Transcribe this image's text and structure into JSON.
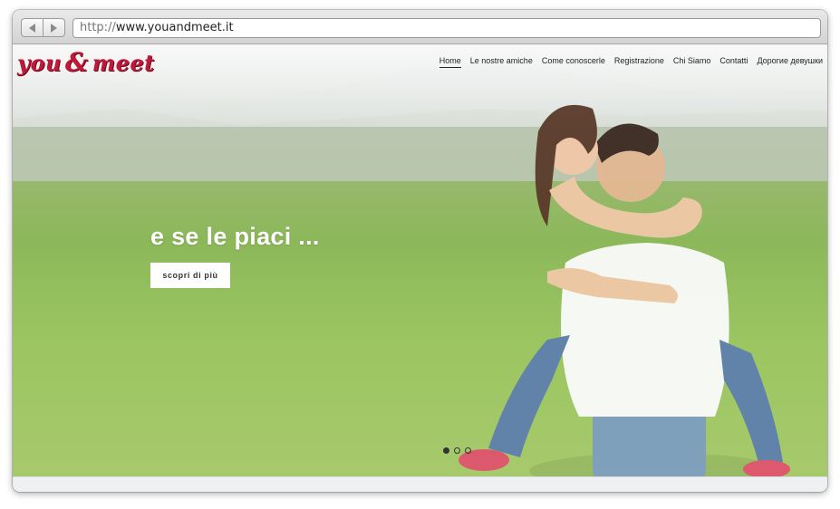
{
  "browser": {
    "url_protocol": "http://",
    "url_host": "www.youandmeet.it"
  },
  "site": {
    "logo": {
      "part1": "you",
      "amp": "&",
      "part2": "meet"
    },
    "menu": [
      {
        "label": "Home",
        "active": true
      },
      {
        "label": "Le nostre amiche",
        "active": false
      },
      {
        "label": "Come conoscerle",
        "active": false
      },
      {
        "label": "Registrazione",
        "active": false
      },
      {
        "label": "Chi Siamo",
        "active": false
      },
      {
        "label": "Contatti",
        "active": false
      },
      {
        "label": "Дорогие девушки",
        "active": false
      }
    ],
    "hero": {
      "title": "e se le piaci ...",
      "button": "scopri di più"
    },
    "slider": {
      "slides": 3,
      "active": 1
    }
  },
  "colors": {
    "logo": "#c0183a",
    "hero_text": "#ffffff"
  }
}
